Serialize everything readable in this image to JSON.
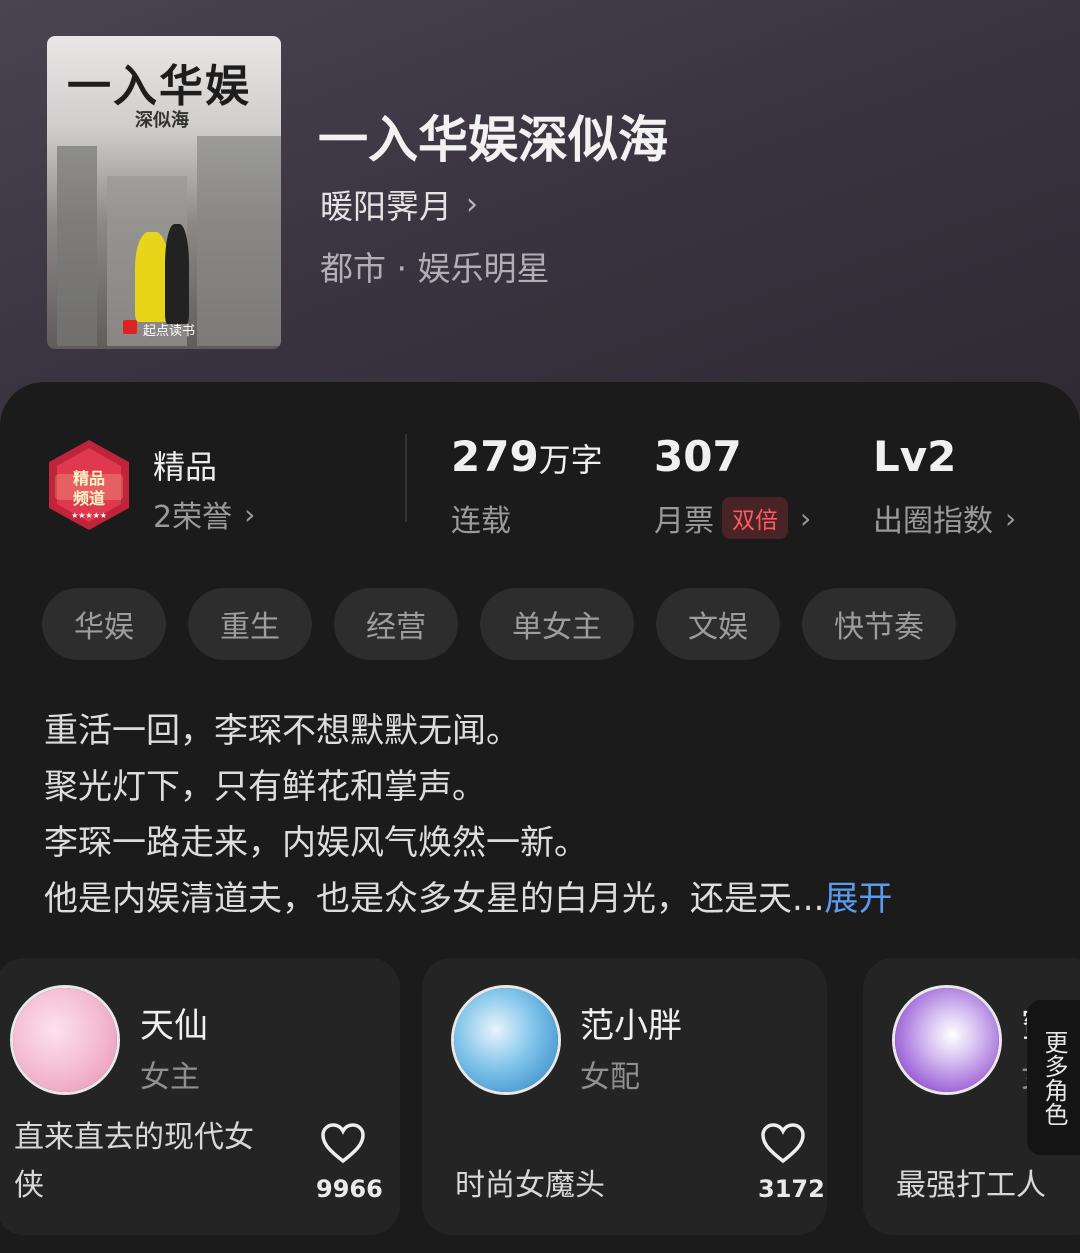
{
  "book": {
    "cover_title": "一入华娱",
    "cover_subtitle": "深似海",
    "cover_brand": "起点读书",
    "title": "一入华娱深似海",
    "author": "暖阳霁月",
    "genre": "都市 · 娱乐明星"
  },
  "stats": {
    "channel_label": "精品",
    "honor": "2荣誉",
    "badge_text": "精品频道",
    "words_value": "279",
    "words_unit": "万字",
    "words_status": "连载",
    "monthly_votes_value": "307",
    "monthly_votes_label": "月票",
    "double_badge": "双倍",
    "level_value": "Lv2",
    "level_label": "出圈指数"
  },
  "tags": [
    "华娱",
    "重生",
    "经营",
    "单女主",
    "文娱",
    "快节奏"
  ],
  "description": {
    "lines": [
      "重活一回，李琛不想默默无闻。",
      "聚光灯下，只有鲜花和掌声。",
      "李琛一路走来，内娱风气焕然一新。",
      "他是内娱清道夫，也是众多女星的白月光，还是天..."
    ],
    "expand_label": "展开"
  },
  "characters": [
    {
      "name": "天仙",
      "role": "女主",
      "desc_line1": "直来直去的现代女",
      "desc_line2": "侠",
      "likes": "9966",
      "avatar_color": "#f3b8cf"
    },
    {
      "name": "范小胖",
      "role": "女配",
      "desc_line1": "时尚女魔头",
      "desc_line2": "",
      "likes": "3172",
      "avatar_color": "#4aa3df"
    },
    {
      "name": "蜜蜜",
      "role": "女配",
      "desc_line1": "最强打工人",
      "desc_line2": "",
      "likes": "",
      "avatar_color": "#9a5cd6"
    }
  ],
  "more_roles_label": "更多角色",
  "colors": {
    "accent_blue": "#5b9bf0",
    "double_red": "#ff5a5f",
    "sheet_bg": "#1b1b1b",
    "hero_bg": "#3a3541"
  }
}
